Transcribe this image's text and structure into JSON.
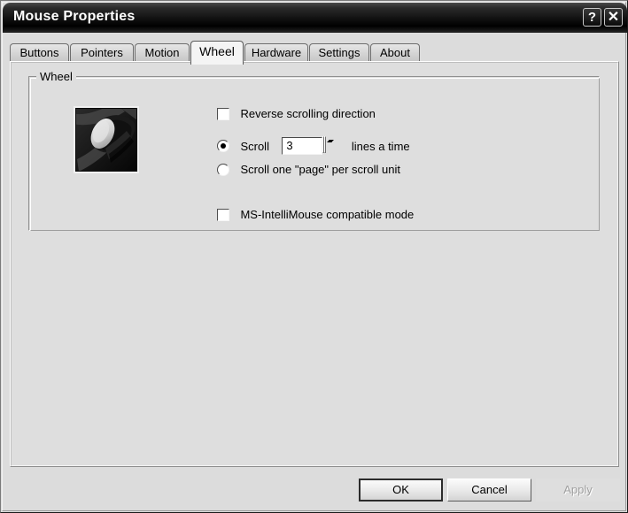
{
  "window": {
    "title": "Mouse Properties",
    "help_button": "?",
    "close_button": "✕"
  },
  "tabs": [
    {
      "label": "Buttons",
      "selected": false
    },
    {
      "label": "Pointers",
      "selected": false
    },
    {
      "label": "Motion",
      "selected": false
    },
    {
      "label": "Wheel",
      "selected": true
    },
    {
      "label": "Hardware",
      "selected": false
    },
    {
      "label": "Settings",
      "selected": false
    },
    {
      "label": "About",
      "selected": false
    }
  ],
  "wheel_panel": {
    "group_title": "Wheel",
    "image_alt": "mouse-wheel-photo",
    "reverse_scrolling": {
      "label": "Reverse scrolling direction",
      "checked": false
    },
    "scroll_lines": {
      "radio_selected": true,
      "prefix_label": "Scroll",
      "value": "3",
      "suffix_label": "lines a time",
      "spinner_up": "▲",
      "spinner_down": "▼"
    },
    "scroll_page": {
      "radio_selected": false,
      "label": "Scroll one \"page\" per scroll unit"
    },
    "intellimouse": {
      "label": "MS-IntelliMouse compatible mode",
      "checked": false
    }
  },
  "footer": {
    "ok": "OK",
    "cancel": "Cancel",
    "apply": "Apply",
    "apply_disabled": true
  }
}
